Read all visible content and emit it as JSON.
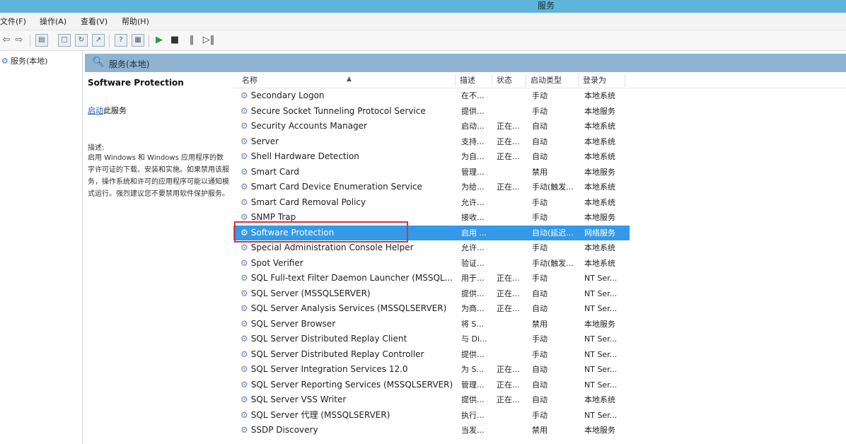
{
  "window": {
    "title": "服务"
  },
  "menu": [
    "文件(F)",
    "操作(A)",
    "查看(V)",
    "帮助(H)"
  ],
  "toolbar": {
    "icons": [
      "back-arrow-icon",
      "forward-arrow-icon",
      "show-hide-tree-icon",
      "properties-icon",
      "refresh-icon",
      "export-list-icon",
      "help-icon",
      "console-icon",
      "start-service-icon",
      "stop-service-icon",
      "pause-service-icon",
      "restart-service-icon"
    ]
  },
  "tree": {
    "root_label": "服务(本地)"
  },
  "header": {
    "label": "服务(本地)"
  },
  "detail": {
    "service_name": "Software Protection",
    "start_link": "启动",
    "start_suffix": "此服务",
    "description_label": "描述:",
    "description_text": "启用 Windows 和 Windows 应用程序的数字许可证的下载、安装和实施。如果禁用该服务，操作系统和许可的应用程序可能以通知模式运行。强烈建议您不要禁用软件保护服务。"
  },
  "columns": {
    "name": "名称",
    "description": "描述",
    "status": "状态",
    "startup": "启动类型",
    "logon": "登录为"
  },
  "services": [
    {
      "name": "Secondary Logon",
      "desc": "在不...",
      "status": "",
      "startup": "手动",
      "logon": "本地系统"
    },
    {
      "name": "Secure Socket Tunneling Protocol Service",
      "desc": "提供...",
      "status": "",
      "startup": "手动",
      "logon": "本地服务"
    },
    {
      "name": "Security Accounts Manager",
      "desc": "启动...",
      "status": "正在...",
      "startup": "自动",
      "logon": "本地系统"
    },
    {
      "name": "Server",
      "desc": "支持...",
      "status": "正在...",
      "startup": "自动",
      "logon": "本地系统"
    },
    {
      "name": "Shell Hardware Detection",
      "desc": "为自...",
      "status": "正在...",
      "startup": "自动",
      "logon": "本地系统"
    },
    {
      "name": "Smart Card",
      "desc": "管理...",
      "status": "",
      "startup": "禁用",
      "logon": "本地服务"
    },
    {
      "name": "Smart Card Device Enumeration Service",
      "desc": "为给...",
      "status": "正在...",
      "startup": "手动(触发...",
      "logon": "本地系统"
    },
    {
      "name": "Smart Card Removal Policy",
      "desc": "允许...",
      "status": "",
      "startup": "手动",
      "logon": "本地系统"
    },
    {
      "name": "SNMP Trap",
      "desc": "接收...",
      "status": "",
      "startup": "手动",
      "logon": "本地服务"
    },
    {
      "name": "Software Protection",
      "desc": "启用 ...",
      "status": "",
      "startup": "自动(延迟...",
      "logon": "网络服务"
    },
    {
      "name": "Special Administration Console Helper",
      "desc": "允许...",
      "status": "",
      "startup": "手动",
      "logon": "本地系统"
    },
    {
      "name": "Spot Verifier",
      "desc": "验证...",
      "status": "",
      "startup": "手动(触发...",
      "logon": "本地系统"
    },
    {
      "name": "SQL Full-text Filter Daemon Launcher (MSSQL...",
      "desc": "用于...",
      "status": "正在...",
      "startup": "手动",
      "logon": "NT Ser..."
    },
    {
      "name": "SQL Server (MSSQLSERVER)",
      "desc": "提供...",
      "status": "正在...",
      "startup": "自动",
      "logon": "NT Ser..."
    },
    {
      "name": "SQL Server Analysis Services (MSSQLSERVER)",
      "desc": "为商...",
      "status": "正在...",
      "startup": "自动",
      "logon": "NT Ser..."
    },
    {
      "name": "SQL Server Browser",
      "desc": "将 S...",
      "status": "",
      "startup": "禁用",
      "logon": "本地服务"
    },
    {
      "name": "SQL Server Distributed Replay Client",
      "desc": "与 Di...",
      "status": "",
      "startup": "手动",
      "logon": "NT Ser..."
    },
    {
      "name": "SQL Server Distributed Replay Controller",
      "desc": "提供...",
      "status": "",
      "startup": "手动",
      "logon": "NT Ser..."
    },
    {
      "name": "SQL Server Integration Services 12.0",
      "desc": "为 S...",
      "status": "正在...",
      "startup": "自动",
      "logon": "NT Ser..."
    },
    {
      "name": "SQL Server Reporting Services (MSSQLSERVER)",
      "desc": "管理...",
      "status": "正在...",
      "startup": "自动",
      "logon": "NT Ser..."
    },
    {
      "name": "SQL Server VSS Writer",
      "desc": "提供...",
      "status": "正在...",
      "startup": "自动",
      "logon": "本地系统"
    },
    {
      "name": "SQL Server 代理 (MSSQLSERVER)",
      "desc": "执行...",
      "status": "",
      "startup": "手动",
      "logon": "NT Ser..."
    },
    {
      "name": "SSDP Discovery",
      "desc": "当发...",
      "status": "",
      "startup": "禁用",
      "logon": "本地服务"
    }
  ],
  "selected_service": "Software Protection"
}
